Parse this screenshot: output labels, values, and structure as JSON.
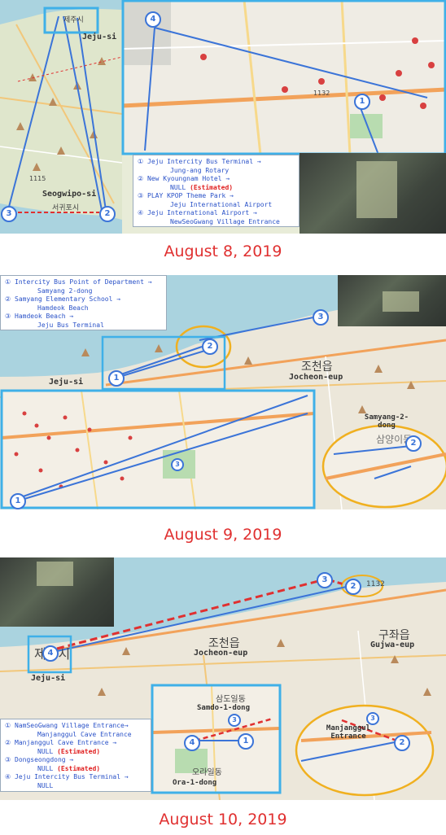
{
  "panel1": {
    "date": "August 8, 2019",
    "city_label": "Jeju-si",
    "city_ko": "제주시",
    "seogwipo_label": "Seogwipo-si",
    "seogwipo_ko": "서귀포시",
    "road_number": "1115",
    "inset_road": "1132",
    "markers": [
      "1",
      "2",
      "3",
      "4"
    ],
    "legend": [
      {
        "num": "①",
        "from": "Jeju Intercity Bus Terminal →",
        "to": "Jung-ang Rotary",
        "est": ""
      },
      {
        "num": "②",
        "from": "New Kyoungnam Hotel →",
        "to": "NULL",
        "est": "(Estimated)"
      },
      {
        "num": "③",
        "from": "PLAY KPOP Theme Park →",
        "to": "Jeju International Airport",
        "est": ""
      },
      {
        "num": "④",
        "from": "Jeju International Airport →",
        "to": "NewSeoGwang Village Entrance",
        "est": ""
      }
    ]
  },
  "panel2": {
    "date": "August 9, 2019",
    "city_label": "Jeju-si",
    "jocheon_ko": "조천읍",
    "jocheon_label": "Jocheon-eup",
    "samyang_label": "Samyang-2-dong",
    "samyang_ko": "삼양이동",
    "markers": [
      "1",
      "2",
      "3"
    ],
    "legend": [
      {
        "num": "①",
        "from": "Intercity Bus Point of Department →",
        "to": "Samyang 2-dong",
        "est": ""
      },
      {
        "num": "②",
        "from": "Samyang Elementary School →",
        "to": "Hamdeok Beach",
        "est": ""
      },
      {
        "num": "③",
        "from": "Hamdeok Beach →",
        "to": "Jeju Bus Terminal",
        "est": ""
      }
    ]
  },
  "panel3": {
    "date": "August 10, 2019",
    "city_label": "Jeju-si",
    "city_ko": "제주시",
    "jocheon_ko": "조천읍",
    "jocheon_label": "Jocheon-eup",
    "gujwa_ko": "구좌읍",
    "gujwa_label": "Gujwa-eup",
    "road_number": "1132",
    "samdo_label": "Samdo-1-dong",
    "samdo_ko": "삼도일동",
    "ora_label": "Ora-1-dong",
    "ora_ko": "오라일동",
    "manjanggul_label": "Manjanggul Entrance",
    "markers": [
      "1",
      "2",
      "3",
      "4"
    ],
    "legend": [
      {
        "num": "①",
        "from": "NamSeoGwang Village Entrance→",
        "to": "Manjanggul Cave Entrance",
        "est": ""
      },
      {
        "num": "②",
        "from": "Manjanggul Cave Entrance →",
        "to": "NULL",
        "est": "(Estimated)"
      },
      {
        "num": "③",
        "from": "Dongseongdong →",
        "to": "NULL",
        "est": "(Estimated)"
      },
      {
        "num": "④",
        "from": "Jeju Intercity Bus Terminal →",
        "to": "NULL",
        "est": ""
      }
    ]
  }
}
